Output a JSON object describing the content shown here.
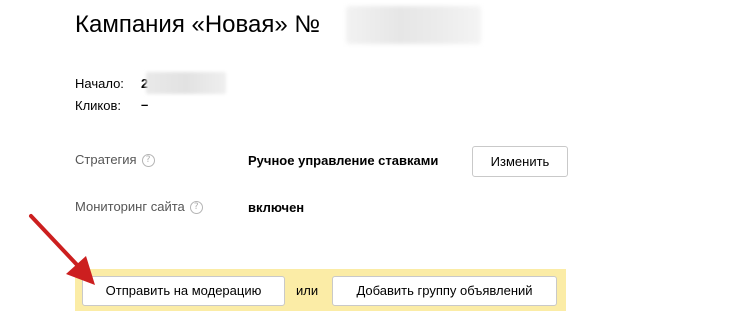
{
  "campaign": {
    "title": "Кампания «Новая» №"
  },
  "info": {
    "start_label": "Начало:",
    "start_value": "2",
    "clicks_label": "Кликов:",
    "clicks_value": "–"
  },
  "strategy": {
    "label": "Стратегия",
    "help_icon": "question-circle-icon",
    "value": "Ручное управление ставками",
    "change_button": "Изменить"
  },
  "monitoring": {
    "label": "Мониторинг сайта",
    "help_icon": "question-circle-icon",
    "value": "включен"
  },
  "actions": {
    "send_to_moderation": "Отправить на модерацию",
    "or": "или",
    "add_ad_group": "Добавить группу объявлений"
  },
  "colors": {
    "action_bar_background": "#fbeca6",
    "arrow": "#cc1f1f"
  }
}
